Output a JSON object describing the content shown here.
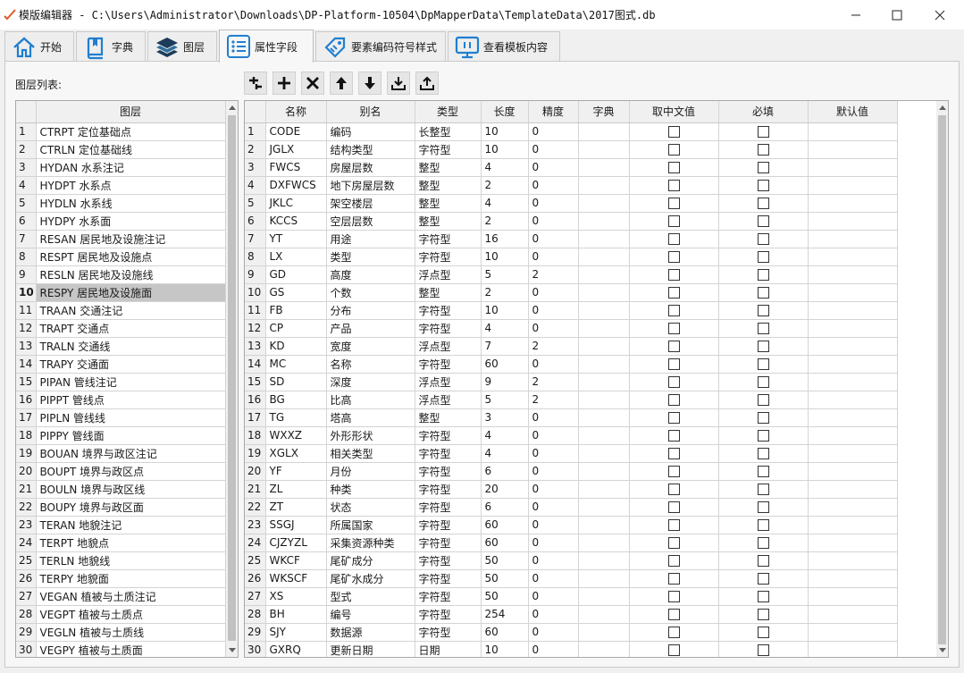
{
  "window": {
    "title": "模版编辑器 - C:\\Users\\Administrator\\Downloads\\DP-Platform-10504\\DpMapperData\\TemplateData\\2017图式.db"
  },
  "tabs": [
    {
      "label": "开始",
      "icon": "home-icon"
    },
    {
      "label": "字典",
      "icon": "book-icon"
    },
    {
      "label": "图层",
      "icon": "layers-icon"
    },
    {
      "label": "属性字段",
      "icon": "list-icon",
      "active": true
    },
    {
      "label": "要素编码符号样式",
      "icon": "tag-icon"
    },
    {
      "label": "查看模板内容",
      "icon": "monitor-icon"
    }
  ],
  "layer_list": {
    "label": "图层列表:",
    "header": "图层",
    "selected_row": 10,
    "rows": [
      "CTRPT 定位基础点",
      "CTRLN 定位基础线",
      "HYDAN 水系注记",
      "HYDPT 水系点",
      "HYDLN 水系线",
      "HYDPY 水系面",
      "RESAN 居民地及设施注记",
      "RESPT 居民地及设施点",
      "RESLN 居民地及设施线",
      "RESPY 居民地及设施面",
      "TRAAN 交通注记",
      "TRAPT 交通点",
      "TRALN 交通线",
      "TRAPY 交通面",
      "PIPAN 管线注记",
      "PIPPT 管线点",
      "PIPLN 管线线",
      "PIPPY 管线面",
      "BOUAN 境界与政区注记",
      "BOUPT 境界与政区点",
      "BOULN 境界与政区线",
      "BOUPY 境界与政区面",
      "TERAN 地貌注记",
      "TERPT 地貌点",
      "TERLN 地貌线",
      "TERPY 地貌面",
      "VEGAN 植被与土质注记",
      "VEGPT 植被与土质点",
      "VEGLN 植被与土质线",
      "VEGPY 植被与土质面"
    ]
  },
  "toolbar": {
    "buttons": [
      "insert-icon",
      "add-icon",
      "delete-icon",
      "move-up-icon",
      "move-down-icon",
      "import-icon",
      "export-icon"
    ]
  },
  "field_table": {
    "columns": [
      "名称",
      "别名",
      "类型",
      "长度",
      "精度",
      "字典",
      "取中文值",
      "必填",
      "默认值"
    ],
    "rows": [
      [
        "CODE",
        "编码",
        "长整型",
        "10",
        "0"
      ],
      [
        "JGLX",
        "结构类型",
        "字符型",
        "10",
        "0"
      ],
      [
        "FWCS",
        "房屋层数",
        "整型",
        "4",
        "0"
      ],
      [
        "DXFWCS",
        "地下房屋层数",
        "整型",
        "2",
        "0"
      ],
      [
        "JKLC",
        "架空楼层",
        "整型",
        "4",
        "0"
      ],
      [
        "KCCS",
        "空层层数",
        "整型",
        "2",
        "0"
      ],
      [
        "YT",
        "用途",
        "字符型",
        "16",
        "0"
      ],
      [
        "LX",
        "类型",
        "字符型",
        "10",
        "0"
      ],
      [
        "GD",
        "高度",
        "浮点型",
        "5",
        "2"
      ],
      [
        "GS",
        "个数",
        "整型",
        "2",
        "0"
      ],
      [
        "FB",
        "分布",
        "字符型",
        "10",
        "0"
      ],
      [
        "CP",
        "产品",
        "字符型",
        "4",
        "0"
      ],
      [
        "KD",
        "宽度",
        "浮点型",
        "7",
        "2"
      ],
      [
        "MC",
        "名称",
        "字符型",
        "60",
        "0"
      ],
      [
        "SD",
        "深度",
        "浮点型",
        "9",
        "2"
      ],
      [
        "BG",
        "比高",
        "浮点型",
        "5",
        "2"
      ],
      [
        "TG",
        "塔高",
        "整型",
        "3",
        "0"
      ],
      [
        "WXXZ",
        "外形形状",
        "字符型",
        "4",
        "0"
      ],
      [
        "XGLX",
        "相关类型",
        "字符型",
        "4",
        "0"
      ],
      [
        "YF",
        "月份",
        "字符型",
        "6",
        "0"
      ],
      [
        "ZL",
        "种类",
        "字符型",
        "20",
        "0"
      ],
      [
        "ZT",
        "状态",
        "字符型",
        "6",
        "0"
      ],
      [
        "SSGJ",
        "所属国家",
        "字符型",
        "60",
        "0"
      ],
      [
        "CJZYZL",
        "采集资源种类",
        "字符型",
        "60",
        "0"
      ],
      [
        "WKCF",
        "尾矿成分",
        "字符型",
        "50",
        "0"
      ],
      [
        "WKSCF",
        "尾矿水成分",
        "字符型",
        "50",
        "0"
      ],
      [
        "XS",
        "型式",
        "字符型",
        "50",
        "0"
      ],
      [
        "BH",
        "编号",
        "字符型",
        "254",
        "0"
      ],
      [
        "SJY",
        "数据源",
        "字符型",
        "60",
        "0"
      ],
      [
        "GXRQ",
        "更新日期",
        "日期",
        "10",
        "0"
      ]
    ]
  }
}
